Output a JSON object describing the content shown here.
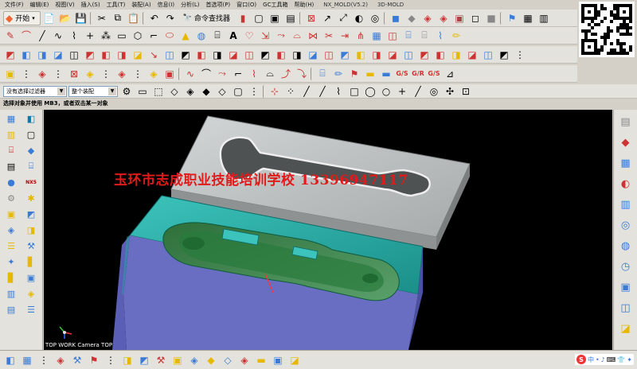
{
  "menubar": {
    "items": [
      "文件(F)",
      "编辑(E)",
      "视图(V)",
      "插入(S)",
      "工具(T)",
      "装配(A)",
      "信息(I)",
      "分析(L)",
      "首选项(P)",
      "窗口(O)",
      "GC工具箱",
      "帮助(H)"
    ],
    "title": "NX_MOLD(V5.2)",
    "subtitle": "3D-MOLD"
  },
  "toolbar": {
    "start_label": "开始",
    "command_finder_label": "命令查找器"
  },
  "selection": {
    "filter_value": "没有选择过滤器",
    "assembly_value": "整个装配"
  },
  "status": {
    "prompt": "选择对象并使用 MB3，或者双击某一对象"
  },
  "viewport": {
    "watermark": "玉环市志成职业技能培训学校 13396947117",
    "view_label": "TOP WORK Camera TOP",
    "colors": {
      "background": "#000000",
      "plate": "#b9bcbc",
      "cavity_block": "#1fa7a0",
      "base_block": "#6a6ec2",
      "watermark": "#e21a1a"
    }
  },
  "ime": {
    "label": "中",
    "icons": [
      "S",
      "中",
      "♪",
      "⌨",
      "👕",
      "✦"
    ]
  },
  "icons": {
    "left_col_a": [
      "layers-icon",
      "book-icon",
      "tube-icon",
      "file-icon",
      "sphere-icon",
      "gear-icon",
      "block-icon",
      "box-icon",
      "stack-icon",
      "wizard-icon"
    ],
    "left_col_b": [
      "part-icon",
      "doc-icon",
      "cube-icon",
      "cylinder-icon",
      "nx-icon",
      "star-icon",
      "shape-icon",
      "mold-icon",
      "tool-icon",
      "chart-icon"
    ],
    "right": [
      "display-icon",
      "assembly-icon",
      "navigator-icon",
      "reuse-icon",
      "web-icon",
      "history-icon",
      "roles-icon",
      "palette-icon",
      "help-icon",
      "info-icon"
    ]
  }
}
